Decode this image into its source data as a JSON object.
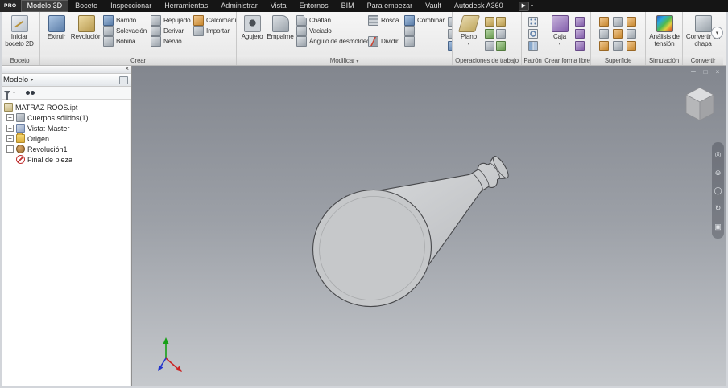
{
  "icons": {
    "caret_down": "▾",
    "close": "×",
    "minimize": "─",
    "restore": "□",
    "play": "▶",
    "plus": "+",
    "nav0": "◎",
    "nav1": "⊕",
    "nav2": "◯",
    "nav3": "↻",
    "nav4": "▣"
  },
  "titlebar": {
    "logo": "PRO",
    "tabs": [
      "Modelo 3D",
      "Boceto",
      "Inspeccionar",
      "Herramientas",
      "Administrar",
      "Vista",
      "Entornos",
      "BIM",
      "Para empezar",
      "Vault",
      "Autodesk A360"
    ]
  },
  "ribbon": {
    "groups": {
      "boceto": {
        "label": "Boceto",
        "iniciar": "Iniciar boceto 2D"
      },
      "crear": {
        "label": "Crear",
        "extruir": "Extruir",
        "revolucion": "Revolución",
        "barrido": "Barrido",
        "solevacion": "Solevación",
        "bobina": "Bobina",
        "repujado": "Repujado",
        "derivar": "Derivar",
        "nervio": "Nervio",
        "calcomania": "Calcomanía",
        "importar": "Importar"
      },
      "modificar": {
        "label": "Modificar",
        "agujero": "Agujero",
        "empalme": "Empalme",
        "chaflan": "Chaflán",
        "vaciado": "Vaciado",
        "angulo": "Ángulo de desmoldeo",
        "rosca": "Rosca",
        "combinar": "Combinar",
        "dividir": "Dividir"
      },
      "trabajo": {
        "label": "Operaciones de trabajo",
        "plano": "Plano"
      },
      "patron": {
        "label": "Patrón"
      },
      "forma_libre": {
        "label": "Crear forma libre",
        "caja": "Caja"
      },
      "superficie": {
        "label": "Superficie"
      },
      "simulacion": {
        "label": "Simulación",
        "analisis": "Análisis de tensión"
      },
      "convertir": {
        "label": "Convertir",
        "chapa": "Convertir en chapa"
      }
    }
  },
  "browser": {
    "title": "Modelo",
    "tree": [
      {
        "label": "MATRAZ ROOS.ipt"
      },
      {
        "label": "Cuerpos sólidos(1)"
      },
      {
        "label": "Vista: Master"
      },
      {
        "label": "Origen"
      },
      {
        "label": "Revolución1"
      },
      {
        "label": "Final de pieza"
      }
    ]
  },
  "colors": {
    "viewport_top": "#82868e",
    "viewport_bottom": "#c6c9cd",
    "flask_body": "#cdcfd1",
    "ribbon_bg": "#eeeeee",
    "tabbar_bg": "#151515"
  }
}
